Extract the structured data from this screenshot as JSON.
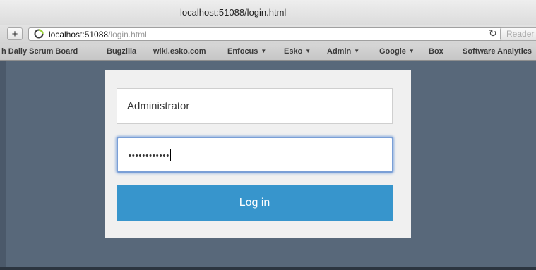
{
  "window": {
    "title": "localhost:51088/login.html"
  },
  "toolbar": {
    "new_tab_label": "+",
    "url_host": "localhost:51088",
    "url_path": "/login.html",
    "reload_icon": "reload-icon",
    "reader_label": "Reader"
  },
  "bookmarks": [
    {
      "label": "h Daily Scrum Board",
      "menu": false
    },
    {
      "label": "Bugzilla",
      "menu": false
    },
    {
      "label": "wiki.esko.com",
      "menu": false
    },
    {
      "label": "Enfocus",
      "menu": true
    },
    {
      "label": "Esko",
      "menu": true
    },
    {
      "label": "Admin",
      "menu": true
    },
    {
      "label": "Google",
      "menu": true
    },
    {
      "label": "Box",
      "menu": false
    },
    {
      "label": "Software Analytics",
      "menu": false
    }
  ],
  "bookmark_caret": "▼",
  "login": {
    "username_value": "Administrator",
    "password_mask": "••••••••••••",
    "button_label": "Log in"
  },
  "colors": {
    "background": "#58687a",
    "panel": "#f0f0f0",
    "button": "#3795cc",
    "focus_ring": "#7a9fd6"
  }
}
